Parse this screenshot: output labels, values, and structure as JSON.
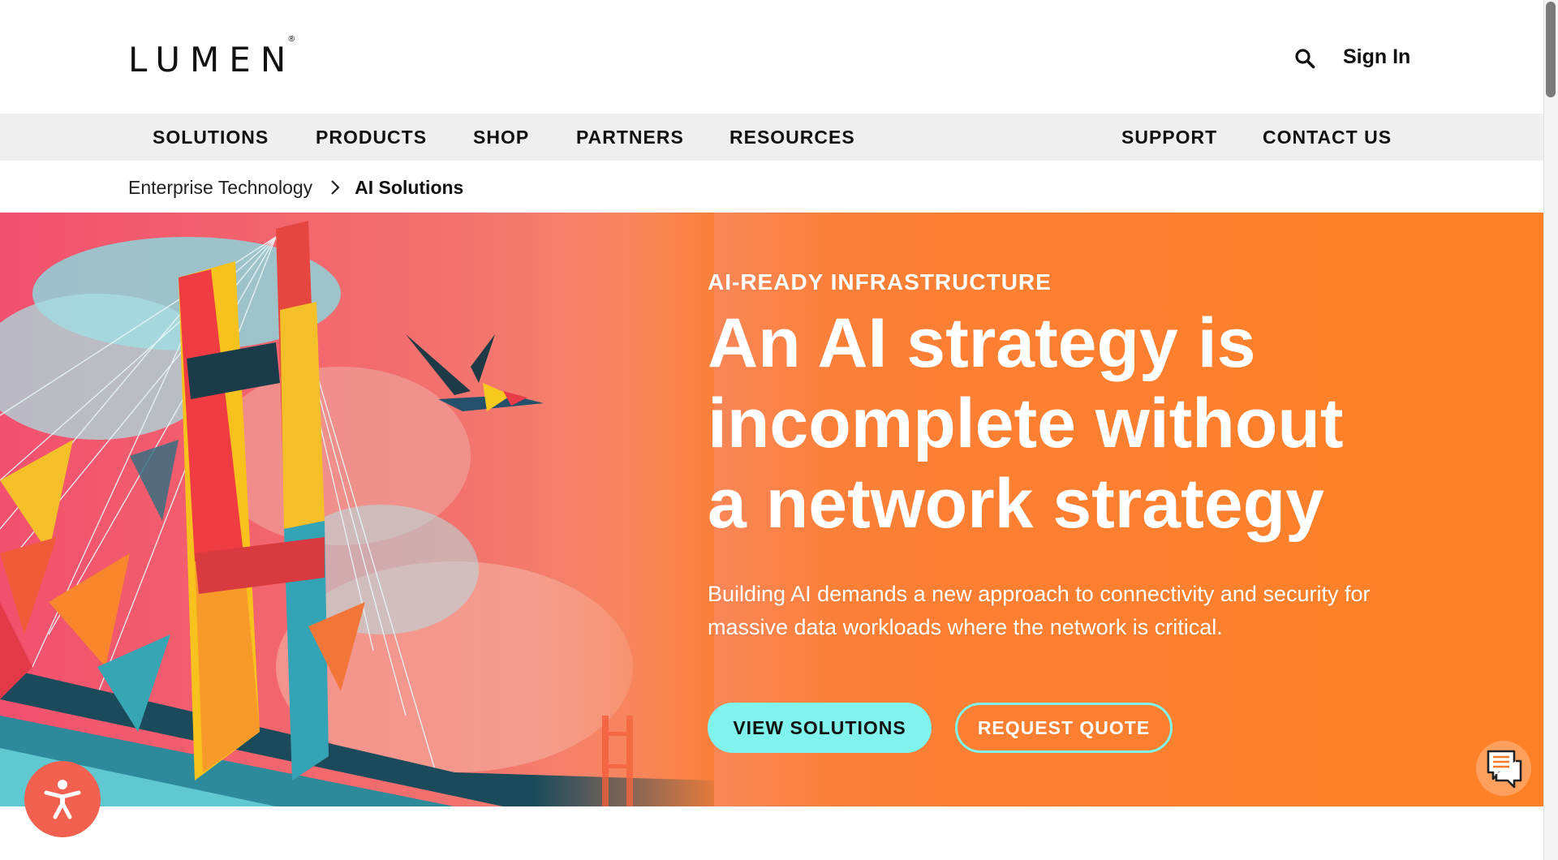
{
  "brand": {
    "logo_text": "LUMEN",
    "logo_mark": "®"
  },
  "header": {
    "search_icon": "search-icon",
    "signin_label": "Sign In"
  },
  "nav": {
    "items": [
      {
        "label": "SOLUTIONS"
      },
      {
        "label": "PRODUCTS"
      },
      {
        "label": "SHOP"
      },
      {
        "label": "PARTNERS"
      },
      {
        "label": "RESOURCES"
      }
    ],
    "right_items": [
      {
        "label": "SUPPORT"
      },
      {
        "label": "CONTACT US"
      }
    ]
  },
  "breadcrumb": {
    "parent": "Enterprise Technology",
    "current": "AI Solutions",
    "separator_icon": "chevron-right-icon"
  },
  "hero": {
    "eyebrow": "AI-READY INFRASTRUCTURE",
    "headline_lines": [
      "An AI strategy is",
      "incomplete without",
      "a network strategy"
    ],
    "subtext": "Building AI demands a new approach to connectivity and security for massive data workloads where the network is critical.",
    "primary_button": "VIEW SOLUTIONS",
    "secondary_button": "REQUEST QUOTE",
    "image_icon": "bridge-artwork-image"
  },
  "widgets": {
    "accessibility_icon": "accessibility-icon",
    "chat_icon": "chat-icon"
  },
  "colors": {
    "accent_teal": "#7ff3ec",
    "hero_orange": "#fe8026",
    "hero_pink": "#f2506e",
    "nav_bg": "#f0eff0",
    "a11y_red": "#f2604f"
  }
}
